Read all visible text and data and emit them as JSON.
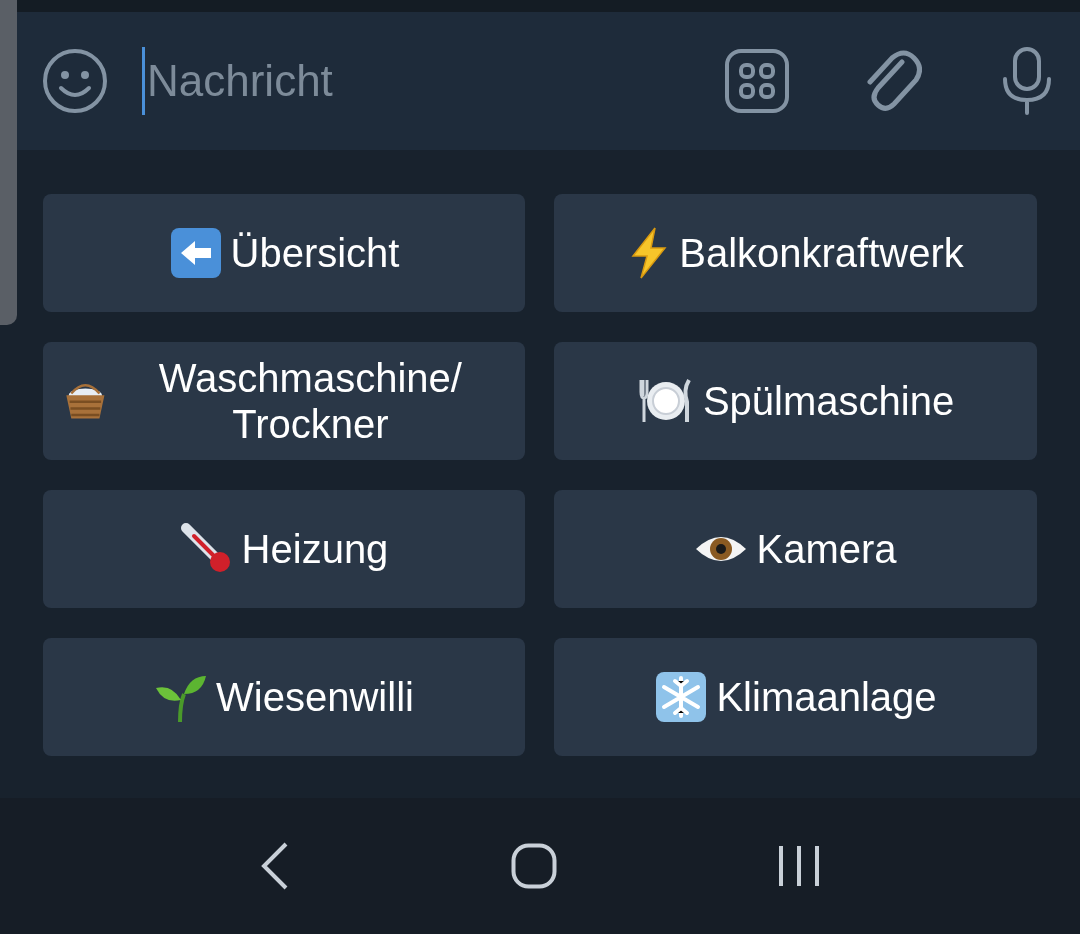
{
  "message_bar": {
    "placeholder": "Nachricht"
  },
  "keyboard": {
    "buttons": [
      {
        "label": "Übersicht"
      },
      {
        "label": "Balkonkraftwerk"
      },
      {
        "label": "Waschmaschine/ Trockner"
      },
      {
        "label": "Spülmaschine"
      },
      {
        "label": "Heizung"
      },
      {
        "label": "Kamera"
      },
      {
        "label": "Wiesenwilli"
      },
      {
        "label": "Klimaanlage"
      }
    ]
  }
}
